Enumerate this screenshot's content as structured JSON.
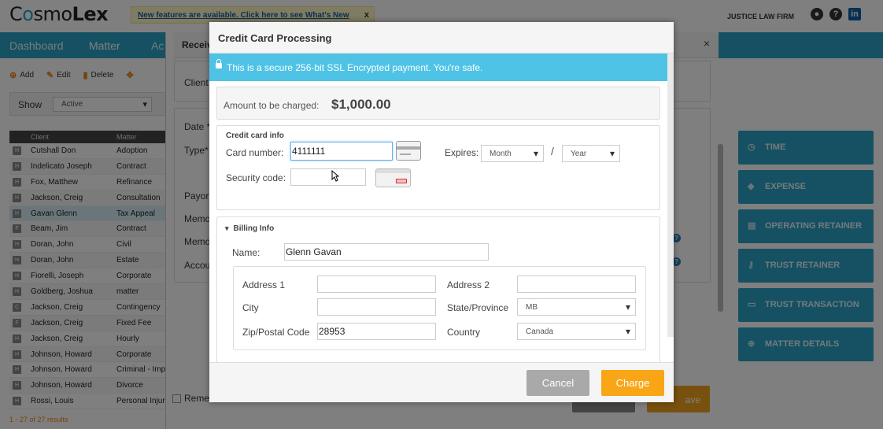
{
  "app": {
    "logo_prefix": "C",
    "logo_middle": "smo",
    "logo_bold": "Lex",
    "notice": "New features are available. Click here to see What's New",
    "notice_close": "x",
    "firm": "JUSTICE LAW FIRM",
    "linkedin": "in",
    "help": "?",
    "nav": [
      "Dashboard",
      "Matter",
      "Ac"
    ],
    "toolbar": [
      "Add",
      "Edit",
      "Delete"
    ],
    "show_label": "Show",
    "show_value": "Active",
    "grid_headers": {
      "client": "Client",
      "matter": "Matter"
    },
    "grid_rows": [
      {
        "ini": "H",
        "client": "Cutshall Don",
        "matter": "Adoption"
      },
      {
        "ini": "H",
        "client": "Indelicato Joseph",
        "matter": "Contract"
      },
      {
        "ini": "H",
        "client": "Fox, Matthew",
        "matter": "Refinance"
      },
      {
        "ini": "H",
        "client": "Jackson, Creig",
        "matter": "Consultation"
      },
      {
        "ini": "H",
        "client": "Gavan Glenn",
        "matter": "Tax Appeal"
      },
      {
        "ini": "F",
        "client": "Beam, Jim",
        "matter": "Contract"
      },
      {
        "ini": "H",
        "client": "Doran, John",
        "matter": "Civil"
      },
      {
        "ini": "H",
        "client": "Doran, John",
        "matter": "Estate"
      },
      {
        "ini": "H",
        "client": "Fiorelli, Joseph",
        "matter": "Corporate"
      },
      {
        "ini": "H",
        "client": "Goldberg, Joshua",
        "matter": "matter"
      },
      {
        "ini": "C",
        "client": "Jackson, Creig",
        "matter": "Contingency"
      },
      {
        "ini": "F",
        "client": "Jackson, Creig",
        "matter": "Fixed Fee"
      },
      {
        "ini": "H",
        "client": "Jackson, Creig",
        "matter": "Hourly"
      },
      {
        "ini": "H",
        "client": "Johnson, Howard",
        "matter": "Corporate"
      },
      {
        "ini": "H",
        "client": "Johnson, Howard",
        "matter": "Criminal - Imp"
      },
      {
        "ini": "H",
        "client": "Johnson, Howard",
        "matter": "Divorce"
      },
      {
        "ini": "H",
        "client": "Rossi, Louis",
        "matter": "Personal Injur"
      }
    ],
    "grid_footer": "1 - 27 of 27 results",
    "panel_title": "Receive",
    "panel_close": "×",
    "panel_fields": [
      "Client",
      "Date *",
      "Type*",
      "Payor",
      "Memo",
      "Memo",
      "Accou"
    ],
    "remember_label": "Remer",
    "bg_save": "ave",
    "right_buttons": [
      "TIME",
      "EXPENSE",
      "OPERATING RETAINER",
      "TRUST RETAINER",
      "TRUST TRANSACTION",
      "MATTER DETAILS"
    ]
  },
  "modal": {
    "title": "Credit Card Processing",
    "ssl_message": "This is a secure 256-bit SSL Encrypted payment. You're safe.",
    "amount_label": "Amount to be charged:",
    "amount_value": "$1,000.00",
    "cc_legend": "Credit card info",
    "card_number_label": "Card number:",
    "card_number_value": "4111111",
    "expires_label": "Expires:",
    "month_value": "Month",
    "slash": "/",
    "year_value": "Year",
    "security_code_label": "Security code:",
    "security_code_value": "",
    "billing_legend": "Billing Info",
    "name_label": "Name:",
    "name_value": "Glenn Gavan",
    "address1_label": "Address 1",
    "address1_value": "",
    "address2_label": "Address 2",
    "address2_value": "",
    "city_label": "City",
    "city_value": "",
    "state_label": "State/Province",
    "state_value": "MB",
    "zip_label": "Zip/Postal Code",
    "zip_value": "28953",
    "country_label": "Country",
    "country_value": "Canada",
    "cancel_label": "Cancel",
    "charge_label": "Charge"
  },
  "colors": {
    "brand": "#2ba3c5",
    "ssl_banner": "#4fc3e6",
    "charge": "#f8a616",
    "cancel": "#a9a9a9"
  }
}
